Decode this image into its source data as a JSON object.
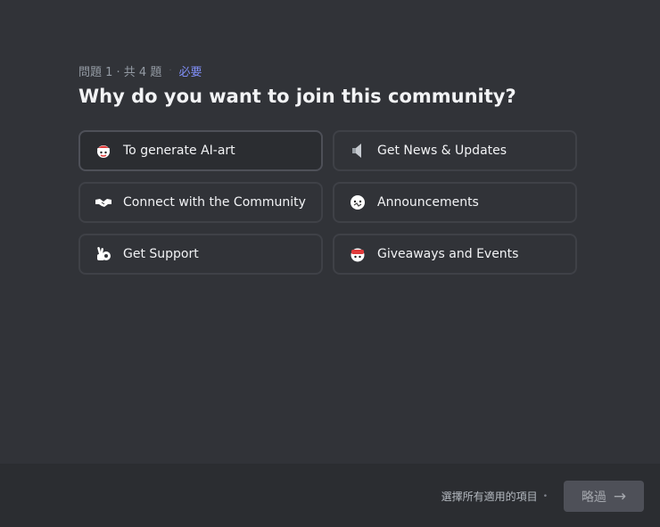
{
  "progress": {
    "text": "問題 1 · 共 4 題",
    "separator": "·",
    "required": "必要"
  },
  "question": "Why do you want to join this community?",
  "options": [
    {
      "label": "To generate AI-art",
      "icon": "santa-bot-emoji-icon",
      "selected": true
    },
    {
      "label": "Get News & Updates",
      "icon": "speaker-icon",
      "selected": false
    },
    {
      "label": "Connect with the Community",
      "icon": "handshake-icon",
      "selected": false
    },
    {
      "label": "Announcements",
      "icon": "announcement-bot-emoji-icon",
      "selected": false
    },
    {
      "label": "Get Support",
      "icon": "ok-hand-icon",
      "selected": false
    },
    {
      "label": "Giveaways and Events",
      "icon": "party-bot-emoji-icon",
      "selected": false
    }
  ],
  "footer": {
    "hint": "選擇所有適用的項目",
    "hint_dot": "•",
    "skip_label": "略過",
    "skip_arrow": "→"
  },
  "colors": {
    "background": "#313338",
    "footer": "#2b2d31",
    "accent": "#7f8ef5",
    "border": "#3f4147"
  }
}
